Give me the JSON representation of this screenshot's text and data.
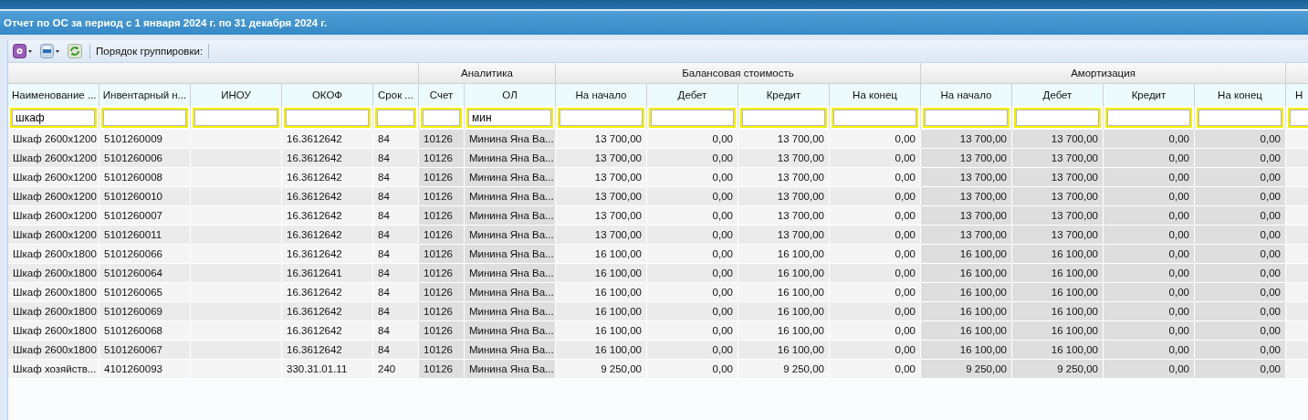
{
  "window": {
    "title": "Отчет по ОС за период с 1 января 2024 г. по 31 декабря 2024 г."
  },
  "toolbar": {
    "grouping_label": "Порядок группировки:"
  },
  "column_groups": [
    {
      "columns": [
        {
          "label": "Наименование ...",
          "kind": "text",
          "shaded": false,
          "filter": "шкаф"
        },
        {
          "label": "Инвентарный н...",
          "kind": "text",
          "shaded": false
        },
        {
          "label": "ИНОУ",
          "kind": "text",
          "shaded": false
        },
        {
          "label": "ОКОФ",
          "kind": "text",
          "shaded": false
        },
        {
          "label": "Срок ...",
          "kind": "text",
          "shaded": false
        }
      ]
    },
    {
      "label": "Аналитика",
      "columns": [
        {
          "label": "Счет",
          "kind": "text",
          "shaded": true
        },
        {
          "label": "ОЛ",
          "kind": "text",
          "shaded": true,
          "filter": "мин"
        }
      ]
    },
    {
      "label": "Балансовая стоимость",
      "columns": [
        {
          "label": "На начало",
          "kind": "number",
          "shaded": false
        },
        {
          "label": "Дебет",
          "kind": "number",
          "shaded": false
        },
        {
          "label": "Кредит",
          "kind": "number",
          "shaded": false
        },
        {
          "label": "На конец",
          "kind": "number",
          "shaded": false
        }
      ]
    },
    {
      "label": "Амортизация",
      "columns": [
        {
          "label": "На начало",
          "kind": "number",
          "shaded": true
        },
        {
          "label": "Дебет",
          "kind": "number",
          "shaded": true
        },
        {
          "label": "Кредит",
          "kind": "number",
          "shaded": true
        },
        {
          "label": "На конец",
          "kind": "number",
          "shaded": true
        }
      ]
    },
    {
      "columns": [
        {
          "label": "Н",
          "kind": "number",
          "shaded": false
        }
      ]
    }
  ],
  "rows": [
    [
      "Шкаф 2600x1200",
      "5101260009",
      null,
      "16.3612642",
      "84",
      "10126",
      "Минина Яна Ва...",
      "13 700,00",
      "0,00",
      "13 700,00",
      "0,00",
      "13 700,00",
      "13 700,00",
      "0,00",
      "0,00"
    ],
    [
      "Шкаф 2600x1200",
      "5101260006",
      null,
      "16.3612642",
      "84",
      "10126",
      "Минина Яна Ва...",
      "13 700,00",
      "0,00",
      "13 700,00",
      "0,00",
      "13 700,00",
      "13 700,00",
      "0,00",
      "0,00"
    ],
    [
      "Шкаф 2600x1200",
      "5101260008",
      null,
      "16.3612642",
      "84",
      "10126",
      "Минина Яна Ва...",
      "13 700,00",
      "0,00",
      "13 700,00",
      "0,00",
      "13 700,00",
      "13 700,00",
      "0,00",
      "0,00"
    ],
    [
      "Шкаф 2600x1200",
      "5101260010",
      null,
      "16.3612642",
      "84",
      "10126",
      "Минина Яна Ва...",
      "13 700,00",
      "0,00",
      "13 700,00",
      "0,00",
      "13 700,00",
      "13 700,00",
      "0,00",
      "0,00"
    ],
    [
      "Шкаф 2600x1200",
      "5101260007",
      null,
      "16.3612642",
      "84",
      "10126",
      "Минина Яна Ва...",
      "13 700,00",
      "0,00",
      "13 700,00",
      "0,00",
      "13 700,00",
      "13 700,00",
      "0,00",
      "0,00"
    ],
    [
      "Шкаф 2600x1200",
      "5101260011",
      null,
      "16.3612642",
      "84",
      "10126",
      "Минина Яна Ва...",
      "13 700,00",
      "0,00",
      "13 700,00",
      "0,00",
      "13 700,00",
      "13 700,00",
      "0,00",
      "0,00"
    ],
    [
      "Шкаф 2600x1800",
      "5101260066",
      null,
      "16.3612642",
      "84",
      "10126",
      "Минина Яна Ва...",
      "16 100,00",
      "0,00",
      "16 100,00",
      "0,00",
      "16 100,00",
      "16 100,00",
      "0,00",
      "0,00"
    ],
    [
      "Шкаф 2600x1800",
      "5101260064",
      null,
      "16.3612641",
      "84",
      "10126",
      "Минина Яна Ва...",
      "16 100,00",
      "0,00",
      "16 100,00",
      "0,00",
      "16 100,00",
      "16 100,00",
      "0,00",
      "0,00"
    ],
    [
      "Шкаф 2600x1800",
      "5101260065",
      null,
      "16.3612642",
      "84",
      "10126",
      "Минина Яна Ва...",
      "16 100,00",
      "0,00",
      "16 100,00",
      "0,00",
      "16 100,00",
      "16 100,00",
      "0,00",
      "0,00"
    ],
    [
      "Шкаф 2600x1800",
      "5101260069",
      null,
      "16.3612642",
      "84",
      "10126",
      "Минина Яна Ва...",
      "16 100,00",
      "0,00",
      "16 100,00",
      "0,00",
      "16 100,00",
      "16 100,00",
      "0,00",
      "0,00"
    ],
    [
      "Шкаф 2600x1800",
      "5101260068",
      null,
      "16.3612642",
      "84",
      "10126",
      "Минина Яна Ва...",
      "16 100,00",
      "0,00",
      "16 100,00",
      "0,00",
      "16 100,00",
      "16 100,00",
      "0,00",
      "0,00"
    ],
    [
      "Шкаф 2600x1800",
      "5101260067",
      null,
      "16.3612642",
      "84",
      "10126",
      "Минина Яна Ва...",
      "16 100,00",
      "0,00",
      "16 100,00",
      "0,00",
      "16 100,00",
      "16 100,00",
      "0,00",
      "0,00"
    ],
    [
      "Шкаф хозяйств...",
      "4101260093",
      null,
      "330.31.01.11",
      "240",
      "10126",
      "Минина Яна Ва...",
      "9 250,00",
      "0,00",
      "9 250,00",
      "0,00",
      "9 250,00",
      "9 250,00",
      "0,00",
      "0,00"
    ]
  ]
}
